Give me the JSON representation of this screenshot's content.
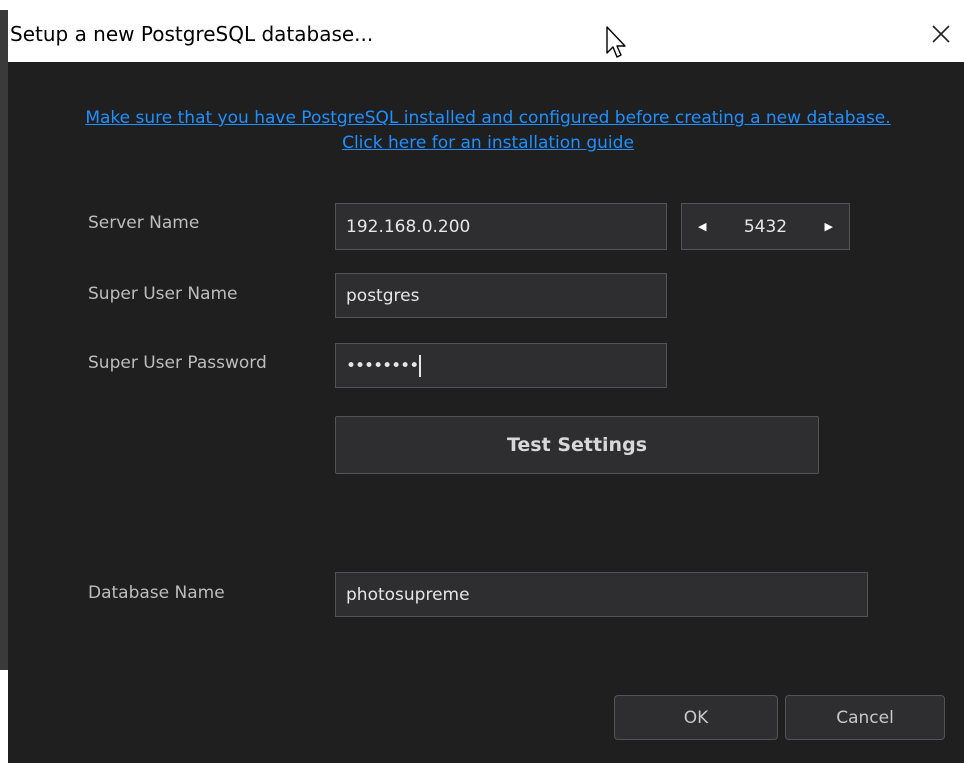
{
  "window": {
    "title": "Setup a new PostgreSQL database..."
  },
  "guide_link": "Make sure that you have PostgreSQL installed and configured before creating a new database. Click here for an installation guide",
  "server": {
    "label": "Server Name",
    "value": "192.168.0.200",
    "port": "5432"
  },
  "superuser": {
    "label": "Super User Name",
    "value": "postgres"
  },
  "password": {
    "label": "Super User Password",
    "masked_value": "••••••••"
  },
  "test_button": "Test Settings",
  "database": {
    "label": "Database Name",
    "value": "photosupreme"
  },
  "buttons": {
    "ok": "OK",
    "cancel": "Cancel"
  },
  "colors": {
    "background": "#1f1f20",
    "field_background": "#2e2e30",
    "field_border": "#545457",
    "link": "#1e90ff",
    "label_text": "#bdbdbd"
  },
  "icons": {
    "close": "close-icon",
    "cursor": "mouse-pointer-icon",
    "port_decrement": "triangle-left-icon",
    "port_increment": "triangle-right-icon"
  }
}
